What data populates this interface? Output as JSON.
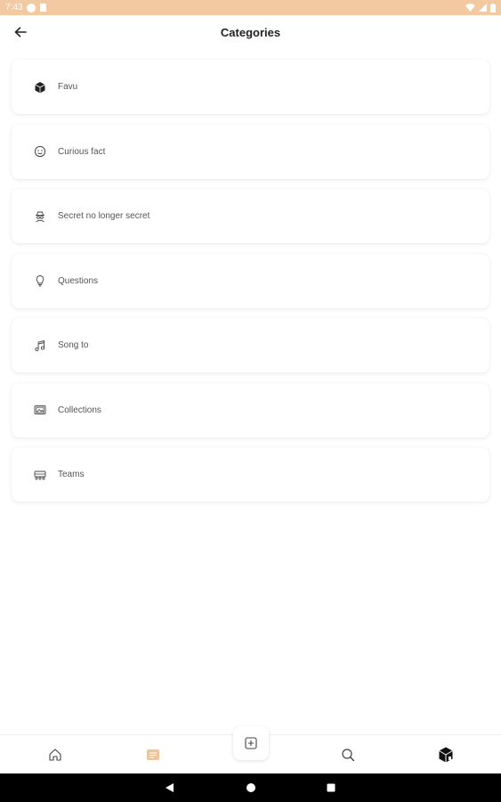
{
  "status_bar": {
    "time": "7:43",
    "icons": [
      "notification-icon",
      "sd-card-icon",
      "wifi-icon",
      "signal-icon",
      "battery-icon"
    ]
  },
  "app_bar": {
    "title": "Categories",
    "back_icon": "arrow-left-icon"
  },
  "categories": [
    {
      "label": "Favu",
      "icon": "cube-icon"
    },
    {
      "label": "Curious fact",
      "icon": "smiley-icon"
    },
    {
      "label": "Secret no longer secret",
      "icon": "spy-icon"
    },
    {
      "label": "Questions",
      "icon": "lightbulb-icon"
    },
    {
      "label": "Song to",
      "icon": "music-note-icon"
    },
    {
      "label": "Collections",
      "icon": "gallery-icon"
    },
    {
      "label": "Teams",
      "icon": "team-icon"
    }
  ],
  "bottom_nav": {
    "items": [
      "home-icon",
      "categories-icon",
      "add-icon",
      "search-icon",
      "profile-cube-icon"
    ],
    "active": "categories-icon"
  },
  "colors": {
    "accent": "#f2c9a0",
    "active_nav": "#f0c49a"
  },
  "system_nav": [
    "back-triangle-icon",
    "home-circle-icon",
    "recents-square-icon"
  ]
}
